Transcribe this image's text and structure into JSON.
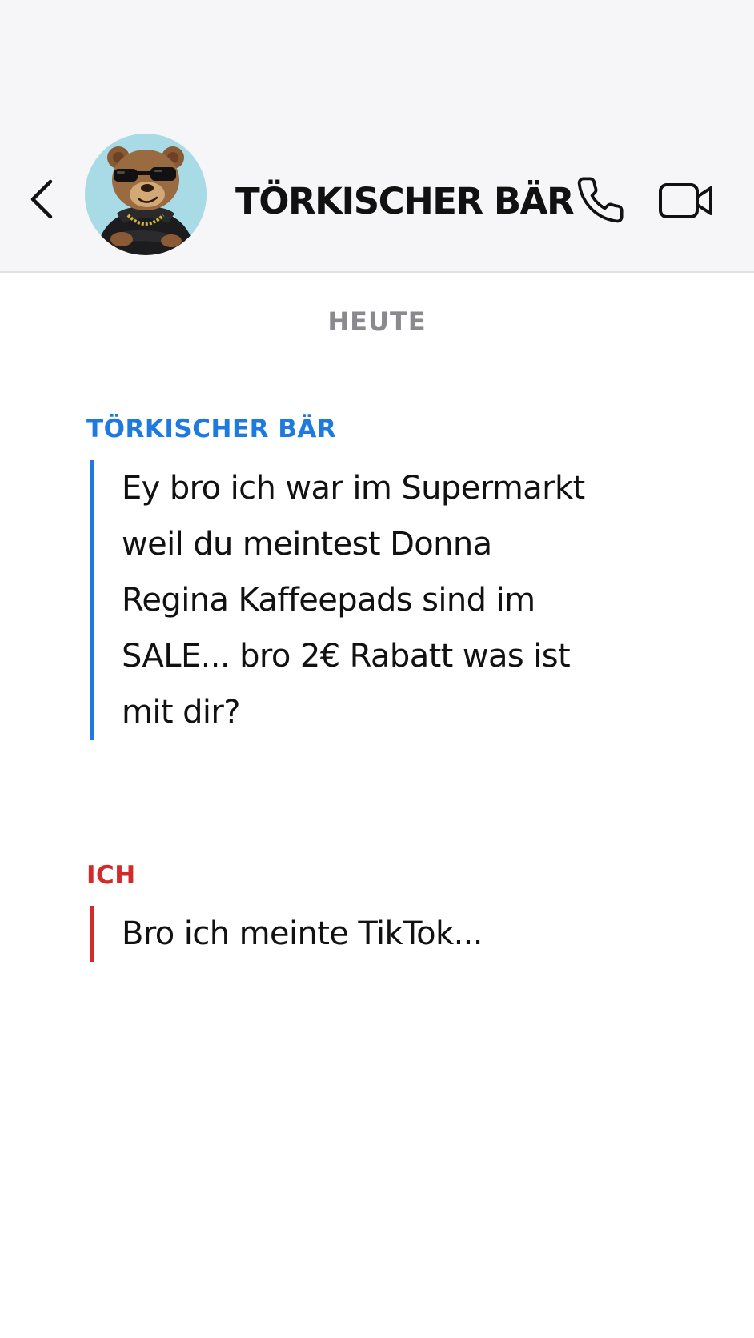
{
  "header": {
    "contact_name": "TÖRKISCHER BÄR",
    "icons": {
      "back": "chevron-left-icon",
      "avatar": "bear-avatar",
      "call": "phone-icon",
      "video": "video-camera-icon"
    }
  },
  "chat": {
    "date_separator": "HEUTE",
    "messages": [
      {
        "sender": "TÖRKISCHER BÄR",
        "text": "Ey bro ich war im Supermarkt weil du meintest Donna Regina Kaffeepads sind im SALE... bro 2€ Rabatt was ist mit dir?",
        "accent_color": "#1f7ae0"
      },
      {
        "sender": "ICH",
        "text": "Bro ich meinte TikTok...",
        "accent_color": "#d32a2a"
      }
    ]
  }
}
